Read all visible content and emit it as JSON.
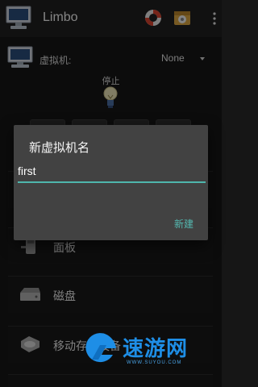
{
  "app": {
    "title": "Limbo"
  },
  "icons": {
    "app": "computer-icon",
    "help": "lifebuoy-icon",
    "settings": "settings-box-icon",
    "overflow": "overflow-menu-icon"
  },
  "machine": {
    "label": "虚拟机:",
    "selected": "None"
  },
  "status": {
    "text": "停止"
  },
  "controls": [
    "play",
    "pause",
    "stop",
    "restart"
  ],
  "menu": [
    {
      "label": "",
      "icon": "cpu-icon"
    },
    {
      "label": "面板",
      "icon": "board-icon"
    },
    {
      "label": "磁盘",
      "icon": "disk-icon"
    },
    {
      "label": "移动存储设备",
      "icon": "removable-drive-icon"
    }
  ],
  "dialog": {
    "title": "新虚拟机名",
    "input_value": "first",
    "confirm_label": "新建"
  },
  "watermark": {
    "text": "速游网",
    "sub": "WWW.SUYOU.COM"
  },
  "colors": {
    "accent": "#54b8b0",
    "dialog_bg": "#424242",
    "watermark": "#1e8ee6"
  }
}
